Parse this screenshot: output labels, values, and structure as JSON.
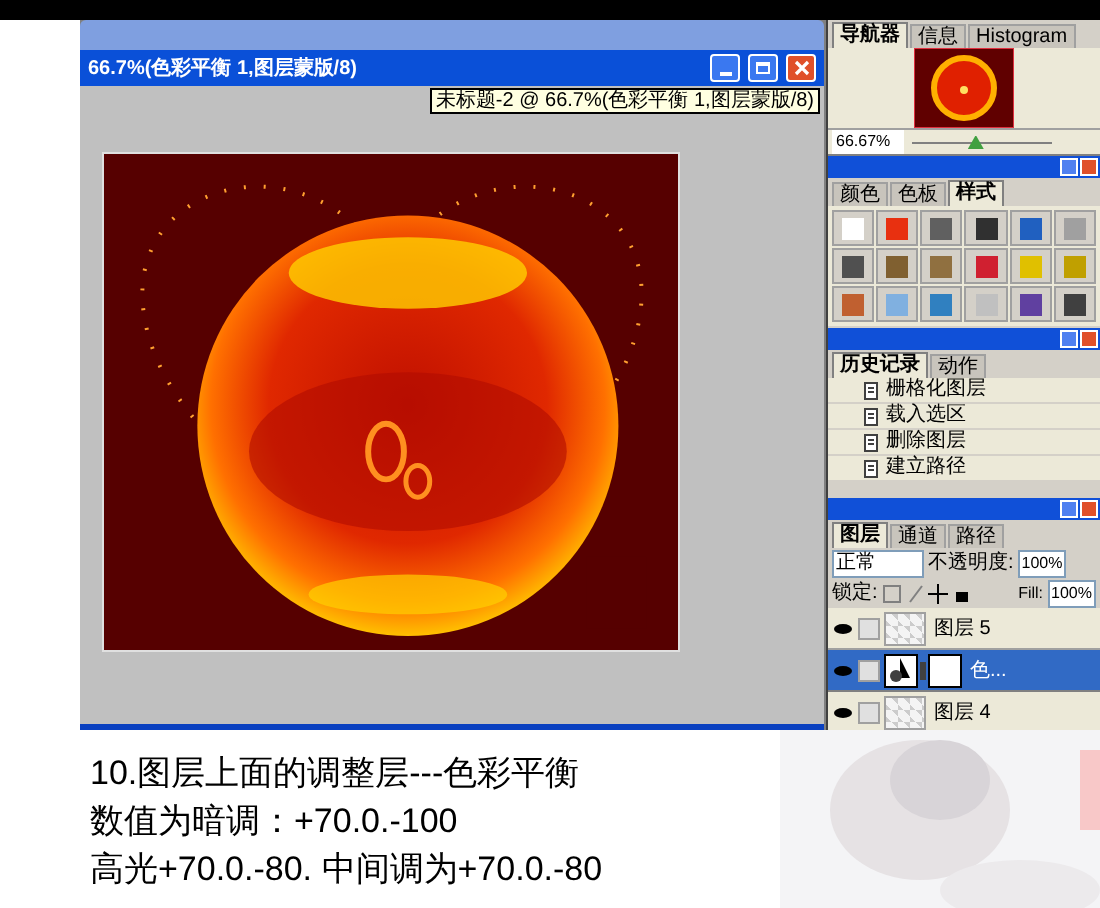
{
  "doc_window": {
    "title": "66.7%(色彩平衡 1,图层蒙版/8)",
    "tooltip": "未标题-2 @ 66.7%(色彩平衡 1,图层蒙版/8)",
    "canvas": {
      "kind": "picture"
    }
  },
  "navigator": {
    "tabs": [
      {
        "label": "导航器",
        "selected": true
      },
      {
        "label": "信息",
        "selected": false
      },
      {
        "label": "Histogram",
        "selected": false
      }
    ],
    "zoom": "66.67%",
    "zoom_slider": {
      "level": 0.45
    }
  },
  "styles_panel": {
    "tabs": [
      {
        "label": "颜色",
        "selected": false
      },
      {
        "label": "色板",
        "selected": false
      },
      {
        "label": "样式",
        "selected": true
      }
    ],
    "swatches": [
      {
        "color": "#ffffff"
      },
      {
        "color": "#e83010"
      },
      {
        "color": "#606060"
      },
      {
        "color": "#303030"
      },
      {
        "color": "#2060c0"
      },
      {
        "color": "#a0a0a0"
      },
      {
        "color": "#505050"
      },
      {
        "color": "#806030"
      },
      {
        "color": "#907040"
      },
      {
        "color": "#d02030"
      },
      {
        "color": "#e0c000"
      },
      {
        "color": "#c0a000"
      },
      {
        "color": "#c06030"
      },
      {
        "color": "#80b0e0"
      },
      {
        "color": "#3080c0"
      },
      {
        "color": "#c0c0c0"
      },
      {
        "color": "#6040a0"
      },
      {
        "color": "#404040"
      }
    ]
  },
  "history": {
    "tabs": [
      {
        "label": "历史记录",
        "selected": true
      },
      {
        "label": "动作",
        "selected": false
      }
    ],
    "items": [
      {
        "label": "栅格化图层"
      },
      {
        "label": "载入选区"
      },
      {
        "label": "删除图层"
      },
      {
        "label": "建立路径"
      }
    ]
  },
  "layers": {
    "tabs": [
      {
        "label": "图层",
        "selected": true
      },
      {
        "label": "通道",
        "selected": false
      },
      {
        "label": "路径",
        "selected": false
      }
    ],
    "blend_mode": "正常",
    "opacity_label": "不透明度:",
    "opacity": "100%",
    "lock_label": "锁定:",
    "fill_label": "Fill:",
    "fill": "100%",
    "items": [
      {
        "name": "图层 5",
        "kind": "pixel",
        "selected": false,
        "visible": true
      },
      {
        "name": "色...",
        "kind": "adjustment",
        "selected": true,
        "visible": true
      },
      {
        "name": "图层 4",
        "kind": "pixel",
        "selected": false,
        "visible": true
      }
    ]
  },
  "caption": [
    "10.图层上面的调整层---色彩平衡",
    "数值为暗调：+70.0.-100",
    "高光+70.0.-80. 中间调为+70.0.-80"
  ],
  "side_picture": {
    "kind": "picture"
  }
}
